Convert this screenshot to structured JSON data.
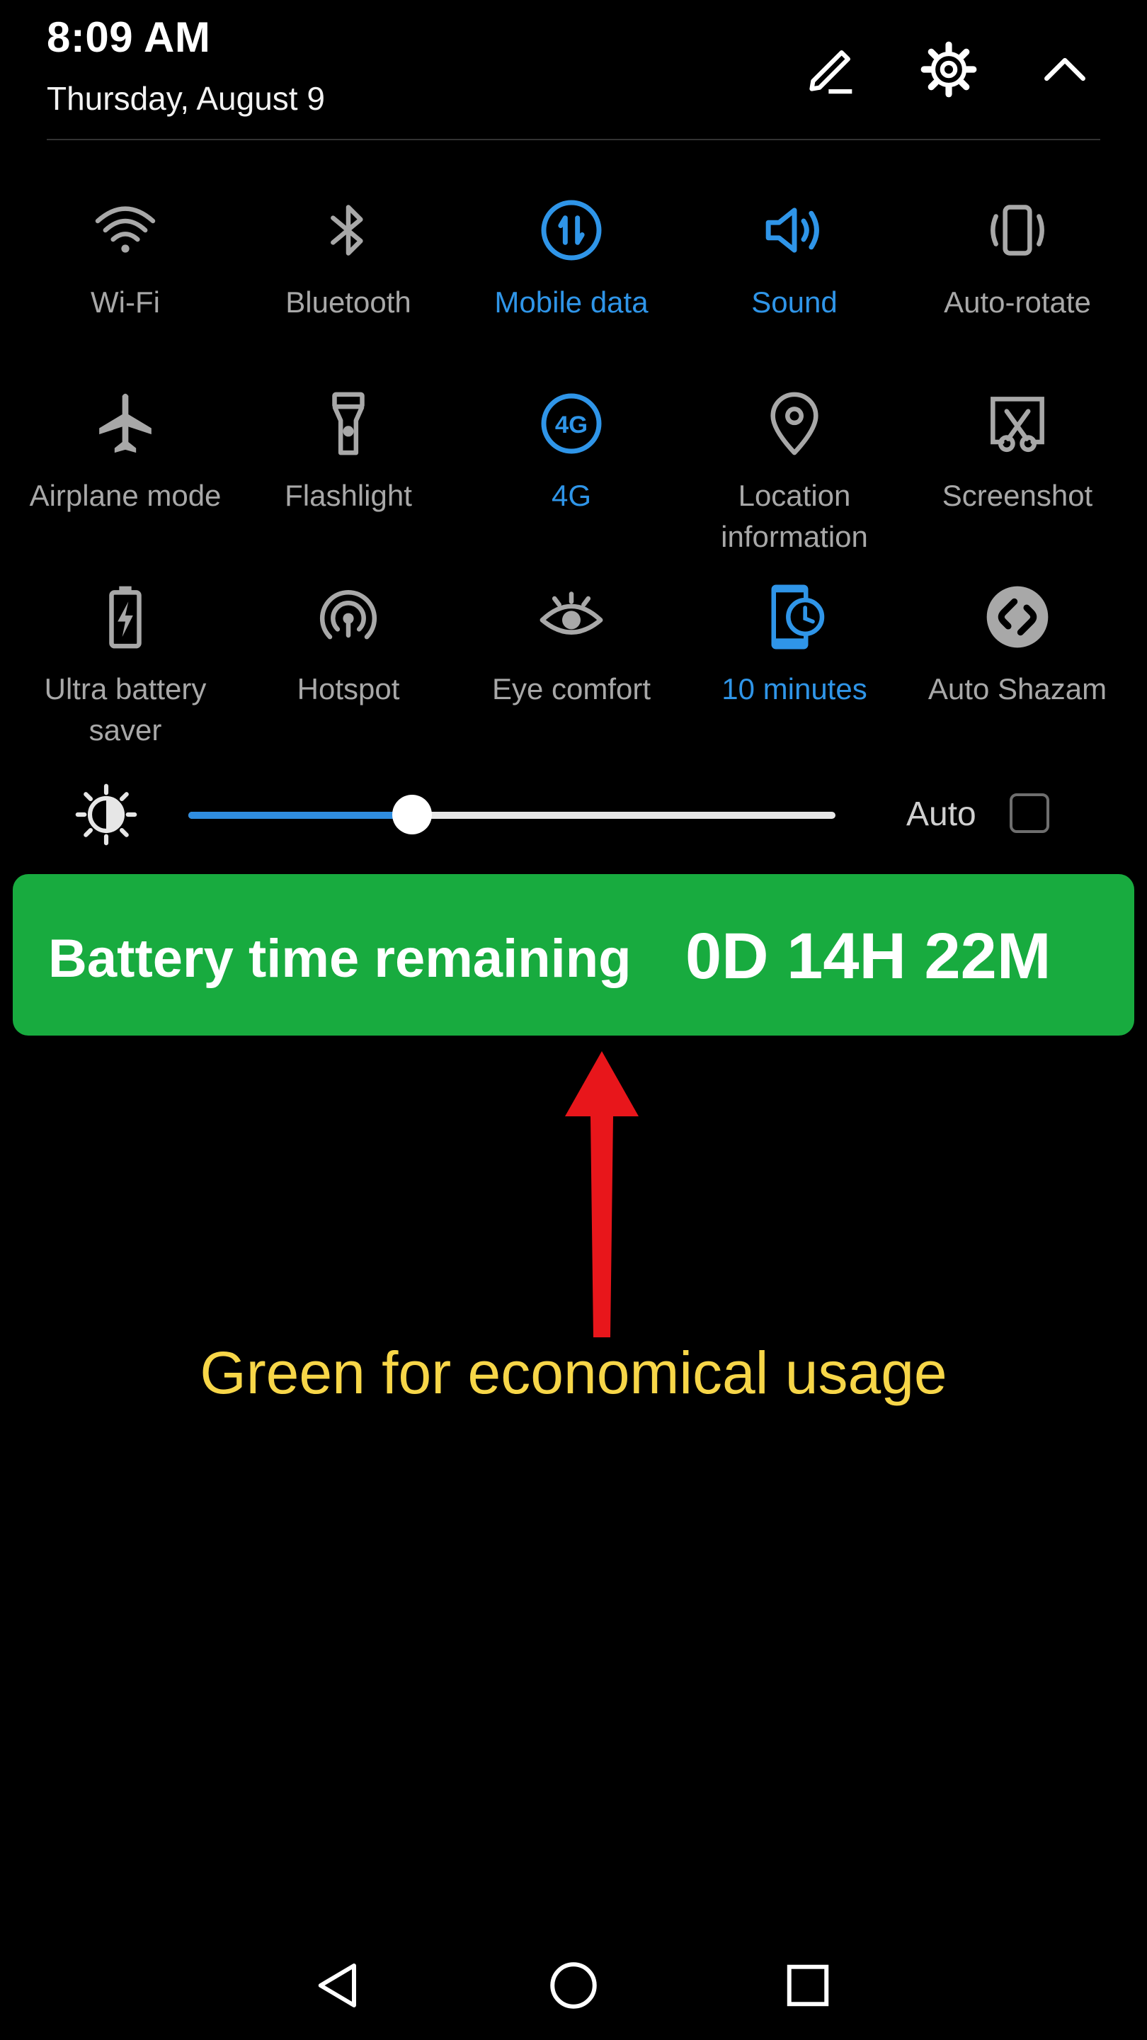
{
  "header": {
    "time": "8:09 AM",
    "date": "Thursday, August 9",
    "actions": [
      {
        "icon": "edit-icon"
      },
      {
        "icon": "settings-gear-icon"
      },
      {
        "icon": "chevron-up-icon"
      }
    ]
  },
  "tiles": [
    {
      "label": "Wi-Fi",
      "icon": "wifi-icon",
      "active": false
    },
    {
      "label": "Bluetooth",
      "icon": "bluetooth-icon",
      "active": false
    },
    {
      "label": "Mobile data",
      "icon": "mobile-data-icon",
      "active": true
    },
    {
      "label": "Sound",
      "icon": "sound-icon",
      "active": true
    },
    {
      "label": "Auto-rotate",
      "icon": "auto-rotate-icon",
      "active": false
    },
    {
      "label": "Airplane mode",
      "icon": "airplane-icon",
      "active": false
    },
    {
      "label": "Flashlight",
      "icon": "flashlight-icon",
      "active": false
    },
    {
      "label": "4G",
      "icon": "4g-icon",
      "active": true
    },
    {
      "label": "Location\ninformation",
      "icon": "location-pin-icon",
      "active": false
    },
    {
      "label": "Screenshot",
      "icon": "screenshot-icon",
      "active": false
    },
    {
      "label": "Ultra battery\nsaver",
      "icon": "battery-saver-icon",
      "active": false
    },
    {
      "label": "Hotspot",
      "icon": "hotspot-icon",
      "active": false
    },
    {
      "label": "Eye comfort",
      "icon": "eye-icon",
      "active": false
    },
    {
      "label": "10 minutes",
      "icon": "screen-timeout-icon",
      "active": true
    },
    {
      "label": "Auto Shazam",
      "icon": "shazam-icon",
      "active": false
    }
  ],
  "brightness": {
    "icon": "brightness-icon",
    "level": 0.346,
    "auto_label": "Auto",
    "auto_checked": false
  },
  "battery_banner": {
    "label": "Battery time remaining",
    "value": "0D 14H 22M",
    "color": "#18ab3f"
  },
  "annotation": {
    "text": "Green for economical usage",
    "arrow_color": "#e8161b",
    "text_color": "#f7d648"
  },
  "navbar": [
    {
      "icon": "back-triangle-icon"
    },
    {
      "icon": "home-circle-icon"
    },
    {
      "icon": "recents-square-icon"
    }
  ],
  "colors": {
    "accent": "#2f95e8",
    "inactive": "#a8a8a8"
  }
}
